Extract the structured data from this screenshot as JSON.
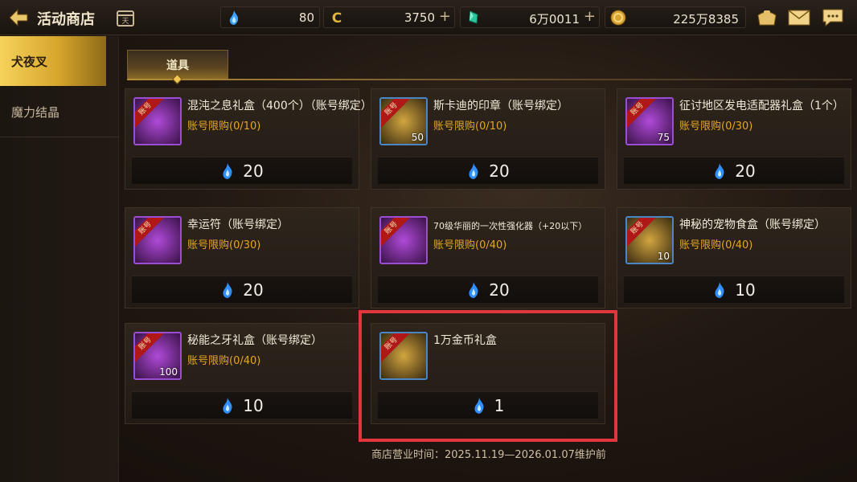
{
  "header": {
    "title": "活动商店",
    "currencies": [
      {
        "icon": "blue-flame-icon",
        "value": "80"
      },
      {
        "icon": "gold-c-coin-icon",
        "value": "3750"
      },
      {
        "icon": "green-crystal-icon",
        "value": "6万0011"
      },
      {
        "icon": "gold-coin-icon",
        "value": "225万8385"
      }
    ]
  },
  "sidebar": {
    "items": [
      {
        "label": "犬夜叉",
        "active": true
      },
      {
        "label": "魔力结晶",
        "active": false
      }
    ]
  },
  "tabs": [
    {
      "label": "道具",
      "active": true
    }
  ],
  "shop_items": [
    {
      "name": "混沌之息礼盒（400个）（账号绑定）",
      "limit": "账号限购(0/10)",
      "price": "20",
      "badge": "账号",
      "qty": "",
      "frame": "purple",
      "icon": "chaos-breath-box-icon"
    },
    {
      "name": "斯卡迪的印章（账号绑定）",
      "limit": "账号限购(0/10)",
      "price": "20",
      "badge": "账号",
      "qty": "50",
      "frame": "blue",
      "icon": "skadi-seal-icon"
    },
    {
      "name": "征讨地区发电适配器礼盒（1个）",
      "limit": "账号限购(0/30)",
      "price": "20",
      "badge": "账号",
      "qty": "75",
      "frame": "purple",
      "icon": "power-adapter-box-icon"
    },
    {
      "name": "幸运符（账号绑定）",
      "limit": "账号限购(0/30)",
      "price": "20",
      "badge": "账号",
      "qty": "",
      "frame": "purple",
      "icon": "lucky-charm-icon"
    },
    {
      "name": "70级华丽的一次性强化器（+20以下）",
      "limit": "账号限购(0/40)",
      "price": "20",
      "badge": "账号",
      "qty": "",
      "frame": "purple",
      "icon": "enhancer-icon"
    },
    {
      "name": "神秘的宠物食盒（账号绑定）",
      "limit": "账号限购(0/40)",
      "price": "10",
      "badge": "账号",
      "qty": "10",
      "frame": "blue",
      "icon": "pet-food-box-icon"
    },
    {
      "name": "秘能之牙礼盒（账号绑定）",
      "limit": "账号限购(0/40)",
      "price": "10",
      "badge": "账号",
      "qty": "100",
      "frame": "purple",
      "icon": "fang-box-icon"
    },
    {
      "name": "1万金币礼盒",
      "limit": "",
      "price": "1",
      "badge": "账号",
      "qty": "",
      "frame": "blue",
      "icon": "gold-chest-icon"
    }
  ],
  "footer": {
    "text": "商店营业时间：2025.11.19—2026.01.07维护前"
  },
  "colors": {
    "accent": "#f0c850",
    "limit": "#e5a622",
    "highlight": "#e1363b"
  }
}
